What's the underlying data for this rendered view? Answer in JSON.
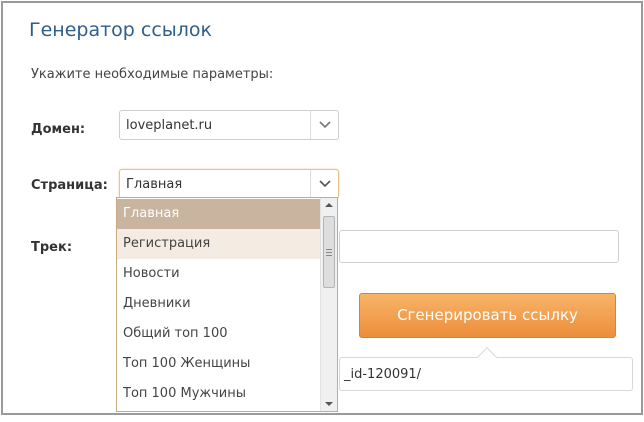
{
  "header": {
    "title": "Генератор ссылок"
  },
  "form": {
    "instructions": "Укажите необходимые параметры:",
    "domain": {
      "label": "Домен:",
      "value": "loveplanet.ru"
    },
    "page": {
      "label": "Страница:",
      "value": "Главная"
    },
    "track": {
      "label": "Трек:",
      "value": ""
    },
    "generate_label": "Сгенерировать ссылку",
    "result": "_id-120091/"
  },
  "dropdown": {
    "items": [
      {
        "label": "Главная",
        "state": "selected"
      },
      {
        "label": "Регистрация",
        "state": "hover"
      },
      {
        "label": "Новости",
        "state": ""
      },
      {
        "label": "Дневники",
        "state": ""
      },
      {
        "label": "Общий топ 100",
        "state": ""
      },
      {
        "label": "Топ 100 Женщины",
        "state": ""
      },
      {
        "label": "Топ 100 Мужчины",
        "state": ""
      }
    ]
  },
  "colors": {
    "title": "#2e5e8a",
    "button": "#ec8e3b",
    "selected_item": "#c9b59f",
    "hover_item": "#f4ece2"
  },
  "icons": {
    "select_arrow": "chevron-down-icon"
  }
}
